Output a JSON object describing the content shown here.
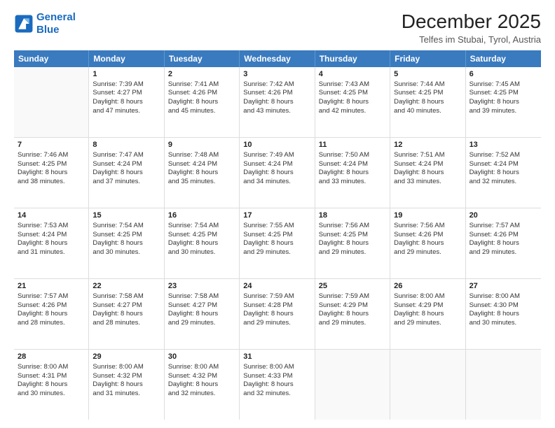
{
  "logo": {
    "line1": "General",
    "line2": "Blue"
  },
  "title": "December 2025",
  "subtitle": "Telfes im Stubai, Tyrol, Austria",
  "days_of_week": [
    "Sunday",
    "Monday",
    "Tuesday",
    "Wednesday",
    "Thursday",
    "Friday",
    "Saturday"
  ],
  "weeks": [
    [
      {
        "day": "",
        "info": ""
      },
      {
        "day": "1",
        "info": "Sunrise: 7:39 AM\nSunset: 4:27 PM\nDaylight: 8 hours\nand 47 minutes."
      },
      {
        "day": "2",
        "info": "Sunrise: 7:41 AM\nSunset: 4:26 PM\nDaylight: 8 hours\nand 45 minutes."
      },
      {
        "day": "3",
        "info": "Sunrise: 7:42 AM\nSunset: 4:26 PM\nDaylight: 8 hours\nand 43 minutes."
      },
      {
        "day": "4",
        "info": "Sunrise: 7:43 AM\nSunset: 4:25 PM\nDaylight: 8 hours\nand 42 minutes."
      },
      {
        "day": "5",
        "info": "Sunrise: 7:44 AM\nSunset: 4:25 PM\nDaylight: 8 hours\nand 40 minutes."
      },
      {
        "day": "6",
        "info": "Sunrise: 7:45 AM\nSunset: 4:25 PM\nDaylight: 8 hours\nand 39 minutes."
      }
    ],
    [
      {
        "day": "7",
        "info": "Sunrise: 7:46 AM\nSunset: 4:25 PM\nDaylight: 8 hours\nand 38 minutes."
      },
      {
        "day": "8",
        "info": "Sunrise: 7:47 AM\nSunset: 4:24 PM\nDaylight: 8 hours\nand 37 minutes."
      },
      {
        "day": "9",
        "info": "Sunrise: 7:48 AM\nSunset: 4:24 PM\nDaylight: 8 hours\nand 35 minutes."
      },
      {
        "day": "10",
        "info": "Sunrise: 7:49 AM\nSunset: 4:24 PM\nDaylight: 8 hours\nand 34 minutes."
      },
      {
        "day": "11",
        "info": "Sunrise: 7:50 AM\nSunset: 4:24 PM\nDaylight: 8 hours\nand 33 minutes."
      },
      {
        "day": "12",
        "info": "Sunrise: 7:51 AM\nSunset: 4:24 PM\nDaylight: 8 hours\nand 33 minutes."
      },
      {
        "day": "13",
        "info": "Sunrise: 7:52 AM\nSunset: 4:24 PM\nDaylight: 8 hours\nand 32 minutes."
      }
    ],
    [
      {
        "day": "14",
        "info": "Sunrise: 7:53 AM\nSunset: 4:24 PM\nDaylight: 8 hours\nand 31 minutes."
      },
      {
        "day": "15",
        "info": "Sunrise: 7:54 AM\nSunset: 4:25 PM\nDaylight: 8 hours\nand 30 minutes."
      },
      {
        "day": "16",
        "info": "Sunrise: 7:54 AM\nSunset: 4:25 PM\nDaylight: 8 hours\nand 30 minutes."
      },
      {
        "day": "17",
        "info": "Sunrise: 7:55 AM\nSunset: 4:25 PM\nDaylight: 8 hours\nand 29 minutes."
      },
      {
        "day": "18",
        "info": "Sunrise: 7:56 AM\nSunset: 4:25 PM\nDaylight: 8 hours\nand 29 minutes."
      },
      {
        "day": "19",
        "info": "Sunrise: 7:56 AM\nSunset: 4:26 PM\nDaylight: 8 hours\nand 29 minutes."
      },
      {
        "day": "20",
        "info": "Sunrise: 7:57 AM\nSunset: 4:26 PM\nDaylight: 8 hours\nand 29 minutes."
      }
    ],
    [
      {
        "day": "21",
        "info": "Sunrise: 7:57 AM\nSunset: 4:26 PM\nDaylight: 8 hours\nand 28 minutes."
      },
      {
        "day": "22",
        "info": "Sunrise: 7:58 AM\nSunset: 4:27 PM\nDaylight: 8 hours\nand 28 minutes."
      },
      {
        "day": "23",
        "info": "Sunrise: 7:58 AM\nSunset: 4:27 PM\nDaylight: 8 hours\nand 29 minutes."
      },
      {
        "day": "24",
        "info": "Sunrise: 7:59 AM\nSunset: 4:28 PM\nDaylight: 8 hours\nand 29 minutes."
      },
      {
        "day": "25",
        "info": "Sunrise: 7:59 AM\nSunset: 4:29 PM\nDaylight: 8 hours\nand 29 minutes."
      },
      {
        "day": "26",
        "info": "Sunrise: 8:00 AM\nSunset: 4:29 PM\nDaylight: 8 hours\nand 29 minutes."
      },
      {
        "day": "27",
        "info": "Sunrise: 8:00 AM\nSunset: 4:30 PM\nDaylight: 8 hours\nand 30 minutes."
      }
    ],
    [
      {
        "day": "28",
        "info": "Sunrise: 8:00 AM\nSunset: 4:31 PM\nDaylight: 8 hours\nand 30 minutes."
      },
      {
        "day": "29",
        "info": "Sunrise: 8:00 AM\nSunset: 4:32 PM\nDaylight: 8 hours\nand 31 minutes."
      },
      {
        "day": "30",
        "info": "Sunrise: 8:00 AM\nSunset: 4:32 PM\nDaylight: 8 hours\nand 32 minutes."
      },
      {
        "day": "31",
        "info": "Sunrise: 8:00 AM\nSunset: 4:33 PM\nDaylight: 8 hours\nand 32 minutes."
      },
      {
        "day": "",
        "info": ""
      },
      {
        "day": "",
        "info": ""
      },
      {
        "day": "",
        "info": ""
      }
    ]
  ]
}
